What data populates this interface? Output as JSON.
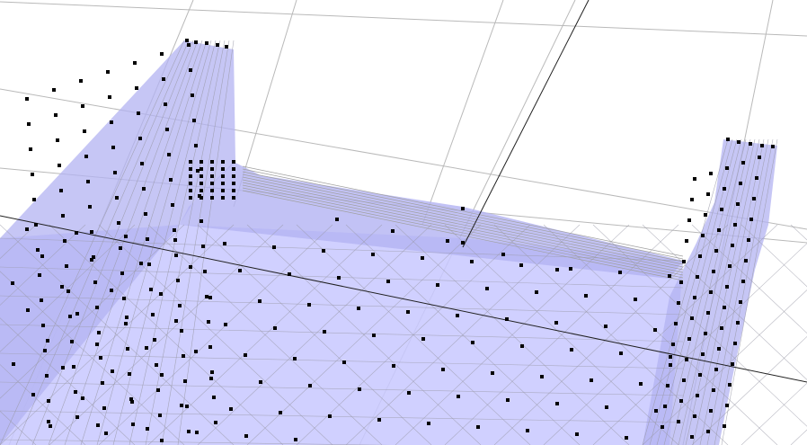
{
  "viewport": {
    "background": "#ffffff",
    "grid_color": "#b9b9b9",
    "axis_color": "#202020",
    "mesh_fill": "#c8c8ff",
    "mesh_fill_dark": "#b3b3f2",
    "mesh_edge": "#9a9aa8",
    "vertex_color": "#000000"
  },
  "scene": {
    "object": "mesh-3d-container",
    "show_grid": true,
    "show_axes": true,
    "show_vertices": true
  }
}
